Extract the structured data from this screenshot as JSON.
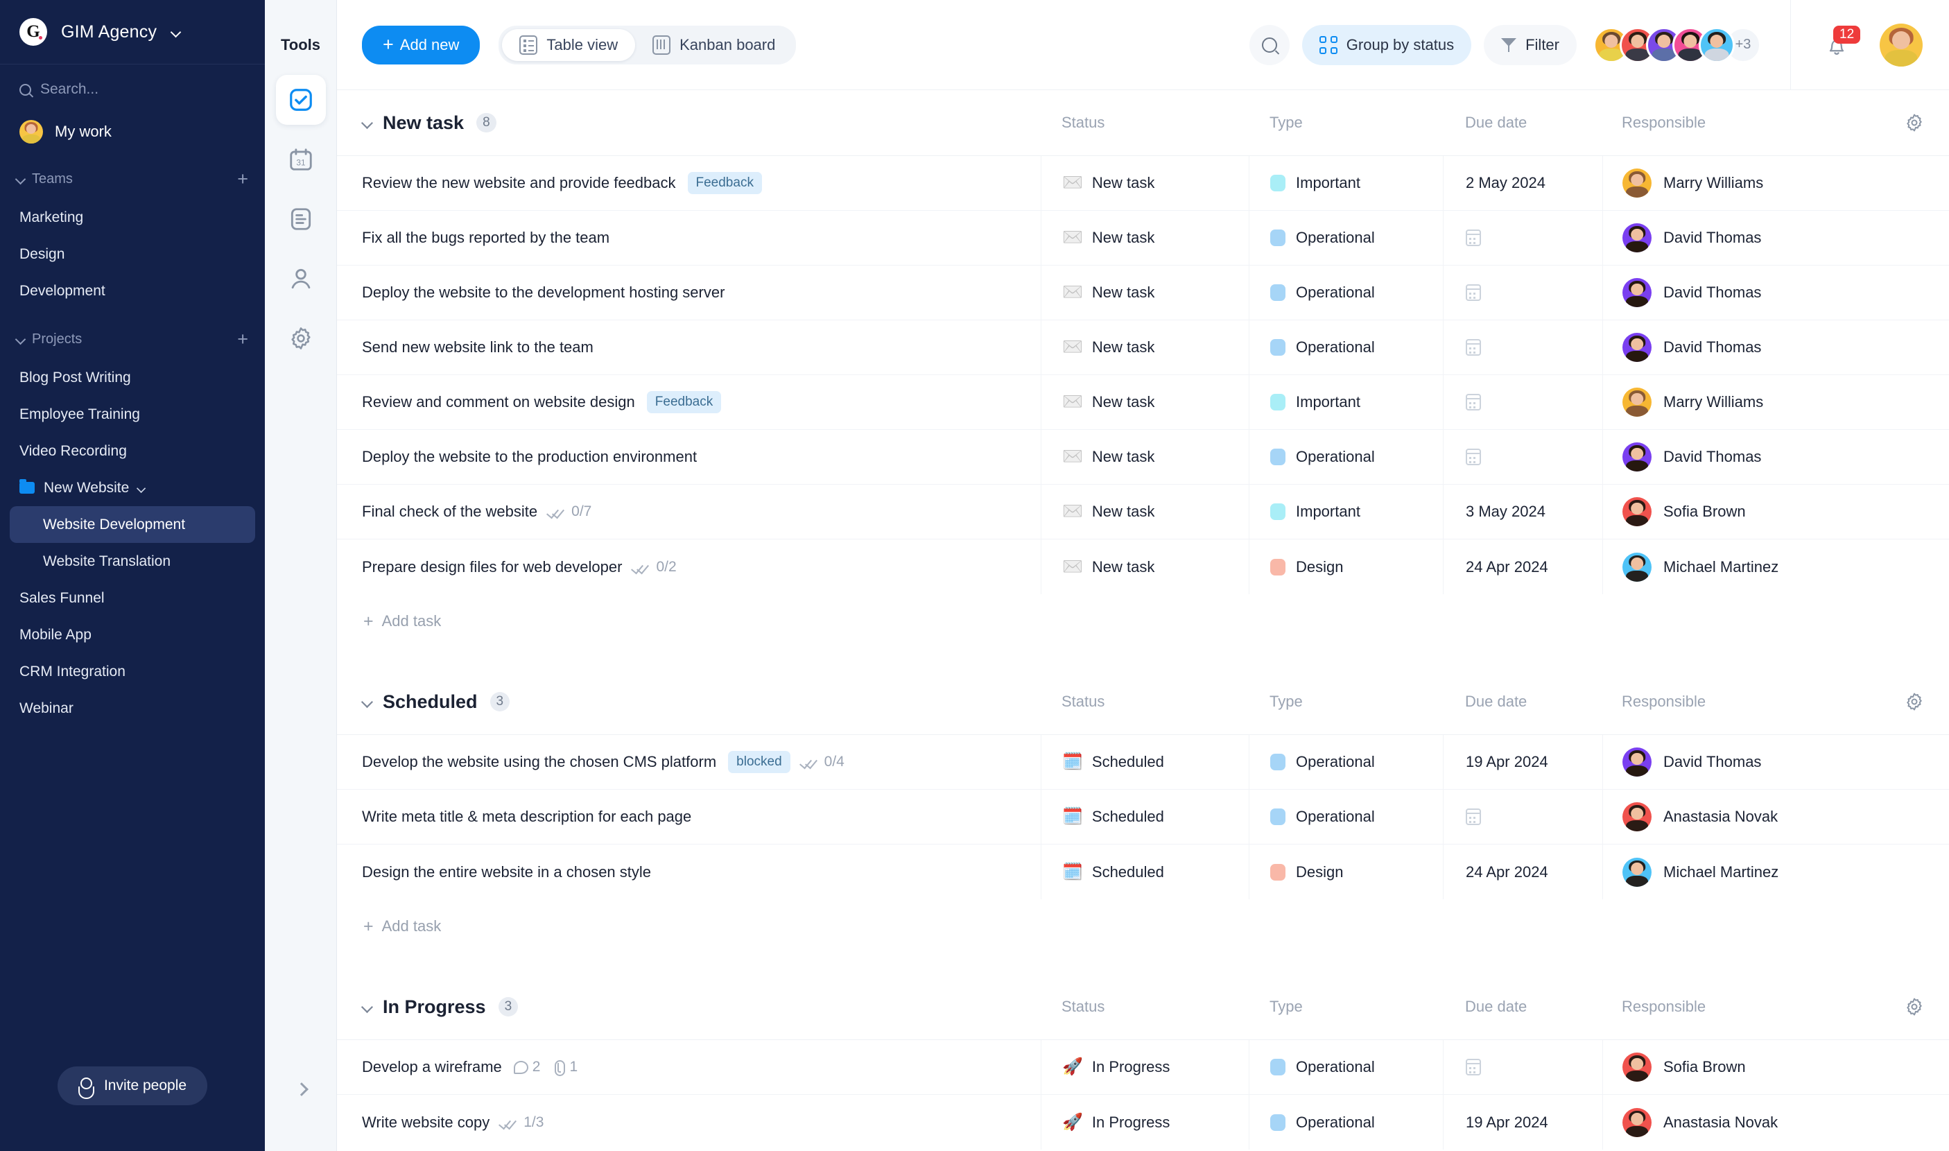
{
  "sidebar": {
    "brand": {
      "logo_letter": "G",
      "name": "GIM Agency",
      "chevron_icon": "chevron-down-icon"
    },
    "search": {
      "placeholder": "Search...",
      "icon": "search-icon"
    },
    "my_work": {
      "label": "My work"
    },
    "teams": {
      "label": "Teams",
      "add_icon": "plus-icon",
      "items": [
        {
          "label": "Marketing"
        },
        {
          "label": "Design"
        },
        {
          "label": "Development"
        }
      ]
    },
    "projects": {
      "label": "Projects",
      "add_icon": "plus-icon",
      "items": [
        {
          "label": "Blog Post Writing",
          "type": "plain"
        },
        {
          "label": "Employee Training",
          "type": "plain"
        },
        {
          "label": "Video Recording",
          "type": "plain"
        },
        {
          "label": "New Website",
          "type": "folder",
          "expanded": true,
          "children": [
            {
              "label": "Website Development",
              "selected": true
            },
            {
              "label": "Website Translation",
              "selected": false
            }
          ]
        },
        {
          "label": "Sales Funnel",
          "type": "plain"
        },
        {
          "label": "Mobile App",
          "type": "plain"
        },
        {
          "label": "CRM Integration",
          "type": "plain"
        },
        {
          "label": "Webinar",
          "type": "plain"
        }
      ]
    },
    "invite": {
      "label": "Invite people",
      "icon": "person-add-icon"
    }
  },
  "tools": {
    "title": "Tools",
    "items": [
      {
        "name": "tasks",
        "icon": "checkbox-icon",
        "active": true
      },
      {
        "name": "calendar",
        "icon": "calendar-31-icon",
        "active": false
      },
      {
        "name": "documents",
        "icon": "document-icon",
        "active": false
      },
      {
        "name": "contacts",
        "icon": "person-icon",
        "active": false
      },
      {
        "name": "settings",
        "icon": "gear-icon",
        "active": false
      }
    ],
    "expand_icon": "chevron-right-icon"
  },
  "toolbar": {
    "add_new": "Add new",
    "views": [
      {
        "label": "Table view",
        "icon": "table-icon",
        "active": true
      },
      {
        "label": "Kanban board",
        "icon": "kanban-icon",
        "active": false
      }
    ],
    "search_icon": "search-icon",
    "group_by": {
      "label": "Group by status",
      "icon": "grid-four-icon"
    },
    "filter": {
      "label": "Filter",
      "icon": "funnel-icon"
    },
    "members_overflow": "+3",
    "notification_count": "12",
    "bell_icon": "bell-icon",
    "member_avatars": [
      {
        "bg": "#f7b733",
        "hair": "#6b4a2f"
      },
      {
        "bg": "#f0524d",
        "hair": "#2d1d14"
      },
      {
        "bg": "#7a4ae8",
        "hair": "#2b2018"
      },
      {
        "bg": "#f24e96",
        "hair": "#1e1412"
      },
      {
        "bg": "#4fc3f7",
        "hair": "#21201e"
      }
    ],
    "current_user_avatar": {
      "bg": "#f7c544",
      "hair": "#b5653a"
    }
  },
  "columns": [
    "Status",
    "Type",
    "Due date",
    "Responsible"
  ],
  "section_gear_icon": "gear-icon",
  "add_task_label": "Add task",
  "type_colors": {
    "Important": "#a9eef7",
    "Operational": "#a6d5f7",
    "Design": "#f9b8a8"
  },
  "people": {
    "Marry Williams": {
      "bg": "#f7b733",
      "hair": "#8a5a34"
    },
    "David Thomas": {
      "bg": "#7a3ff0",
      "hair": "#26180f"
    },
    "Sofia Brown": {
      "bg": "#f0524d",
      "hair": "#2b1a14"
    },
    "Michael Martinez": {
      "bg": "#4fc3f7",
      "hair": "#23211f"
    },
    "Anastasia Novak": {
      "bg": "#f0524d",
      "hair": "#2a1b15"
    }
  },
  "sections": [
    {
      "title": "New task",
      "count": "8",
      "tasks": [
        {
          "name": "Review the new website and provide feedback",
          "tag": "Feedback",
          "status": "New task",
          "status_icon": "envelope-icon",
          "type": "Important",
          "due": "2 May 2024",
          "responsible": "Marry Williams"
        },
        {
          "name": "Fix all the bugs reported by the team",
          "status": "New task",
          "status_icon": "envelope-icon",
          "type": "Operational",
          "due": "",
          "responsible": "David Thomas"
        },
        {
          "name": "Deploy the website to the development hosting server",
          "status": "New task",
          "status_icon": "envelope-icon",
          "type": "Operational",
          "due": "",
          "responsible": "David Thomas"
        },
        {
          "name": "Send new website link to the team",
          "status": "New task",
          "status_icon": "envelope-icon",
          "type": "Operational",
          "due": "",
          "responsible": "David Thomas"
        },
        {
          "name": "Review and comment on website design",
          "tag": "Feedback",
          "status": "New task",
          "status_icon": "envelope-icon",
          "type": "Important",
          "due": "",
          "responsible": "Marry Williams"
        },
        {
          "name": "Deploy the website to the production environment",
          "status": "New task",
          "status_icon": "envelope-icon",
          "type": "Operational",
          "due": "",
          "responsible": "David Thomas"
        },
        {
          "name": "Final check of the website",
          "subtasks": "0/7",
          "status": "New task",
          "status_icon": "envelope-icon",
          "type": "Important",
          "due": "3 May 2024",
          "responsible": "Sofia Brown"
        },
        {
          "name": "Prepare design files for web developer",
          "subtasks": "0/2",
          "status": "New task",
          "status_icon": "envelope-icon",
          "type": "Design",
          "due": "24 Apr 2024",
          "responsible": "Michael Martinez"
        }
      ]
    },
    {
      "title": "Scheduled",
      "count": "3",
      "tasks": [
        {
          "name": "Develop the website using the chosen CMS platform",
          "tag": "blocked",
          "subtasks": "0/4",
          "status": "Scheduled",
          "status_icon": "calendar-icon",
          "type": "Operational",
          "due": "19 Apr 2024",
          "responsible": "David Thomas"
        },
        {
          "name": "Write meta title & meta description for each page",
          "status": "Scheduled",
          "status_icon": "calendar-icon",
          "type": "Operational",
          "due": "",
          "responsible": "Anastasia Novak"
        },
        {
          "name": "Design the entire website in a chosen style",
          "status": "Scheduled",
          "status_icon": "calendar-icon",
          "type": "Design",
          "due": "24 Apr 2024",
          "responsible": "Michael Martinez"
        }
      ]
    },
    {
      "title": "In Progress",
      "count": "3",
      "tasks": [
        {
          "name": "Develop a wireframe",
          "comments": "2",
          "attachments": "1",
          "status": "In Progress",
          "status_icon": "rocket-icon",
          "type": "Operational",
          "due": "",
          "responsible": "Sofia Brown"
        },
        {
          "name": "Write website copy",
          "subtasks": "1/3",
          "status": "In Progress",
          "status_icon": "rocket-icon",
          "type": "Operational",
          "due": "19 Apr 2024",
          "responsible": "Anastasia Novak"
        }
      ]
    }
  ]
}
